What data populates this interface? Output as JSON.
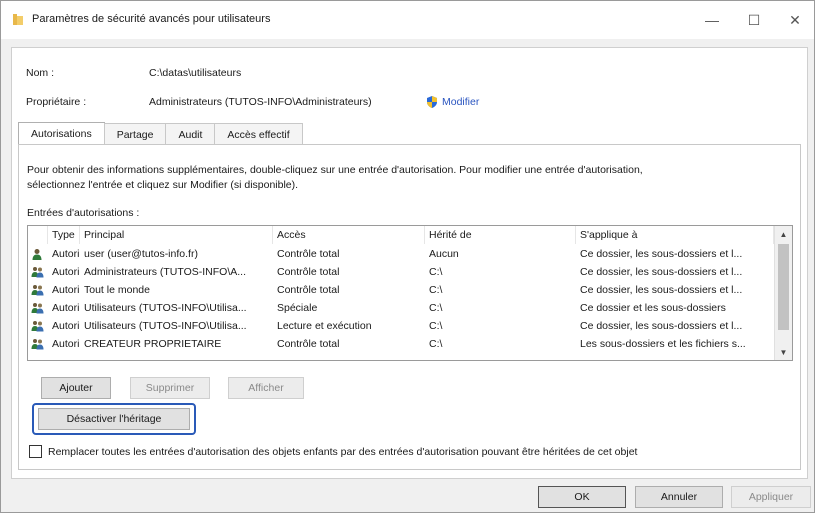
{
  "window": {
    "title": "Paramètres de sécurité avancés pour utilisateurs",
    "minimize_glyph": "—",
    "maximize_glyph": "☐",
    "close_glyph": "✕"
  },
  "object": {
    "name_label": "Nom :",
    "name_value": "C:\\datas\\utilisateurs",
    "owner_label": "Propriétaire :",
    "owner_value": "Administrateurs (TUTOS-INFO\\Administrateurs)",
    "modify_link": "Modifier"
  },
  "tabs": [
    {
      "label": "Autorisations",
      "active": true
    },
    {
      "label": "Partage",
      "active": false
    },
    {
      "label": "Audit",
      "active": false
    },
    {
      "label": "Accès effectif",
      "active": false
    }
  ],
  "permissions": {
    "info_line1": "Pour obtenir des informations supplémentaires, double-cliquez sur une entrée d'autorisation. Pour modifier une entrée d'autorisation,",
    "info_line2": "sélectionnez l'entrée et cliquez sur Modifier (si disponible).",
    "entries_label": "Entrées d'autorisations :",
    "columns": [
      "Type",
      "Principal",
      "Accès",
      "Hérité de",
      "S'applique à"
    ],
    "entries": [
      {
        "icon": "user-icon",
        "type": "Autori...",
        "principal": "user (user@tutos-info.fr)",
        "access": "Contrôle total",
        "inherited_from": "Aucun",
        "applies_to": "Ce dossier, les sous-dossiers et l..."
      },
      {
        "icon": "group-icon",
        "type": "Autori...",
        "principal": "Administrateurs (TUTOS-INFO\\A...",
        "access": "Contrôle total",
        "inherited_from": "C:\\",
        "applies_to": "Ce dossier, les sous-dossiers et l..."
      },
      {
        "icon": "group-icon",
        "type": "Autori...",
        "principal": "Tout le monde",
        "access": "Contrôle total",
        "inherited_from": "C:\\",
        "applies_to": "Ce dossier, les sous-dossiers et l..."
      },
      {
        "icon": "group-icon",
        "type": "Autori...",
        "principal": "Utilisateurs (TUTOS-INFO\\Utilisa...",
        "access": "Spéciale",
        "inherited_from": "C:\\",
        "applies_to": "Ce dossier et les sous-dossiers"
      },
      {
        "icon": "group-icon",
        "type": "Autori...",
        "principal": "Utilisateurs (TUTOS-INFO\\Utilisa...",
        "access": "Lecture et exécution",
        "inherited_from": "C:\\",
        "applies_to": "Ce dossier, les sous-dossiers et l..."
      },
      {
        "icon": "group-icon",
        "type": "Autori...",
        "principal": "CREATEUR PROPRIETAIRE",
        "access": "Contrôle total",
        "inherited_from": "C:\\",
        "applies_to": "Les sous-dossiers et les fichiers s..."
      }
    ],
    "add_button": "Ajouter",
    "remove_button": "Supprimer",
    "view_button": "Afficher",
    "disable_inheritance_button": "Désactiver l'héritage",
    "replace_checkbox_label": "Remplacer toutes les entrées d'autorisation des objets enfants par des entrées d'autorisation pouvant être héritées de cet objet",
    "replace_checked": false
  },
  "footer": {
    "ok": "OK",
    "cancel": "Annuler",
    "apply": "Appliquer"
  },
  "colors": {
    "highlight": "#2a5ab8",
    "link": "#2a55c0",
    "folder": "#e8b84a"
  }
}
